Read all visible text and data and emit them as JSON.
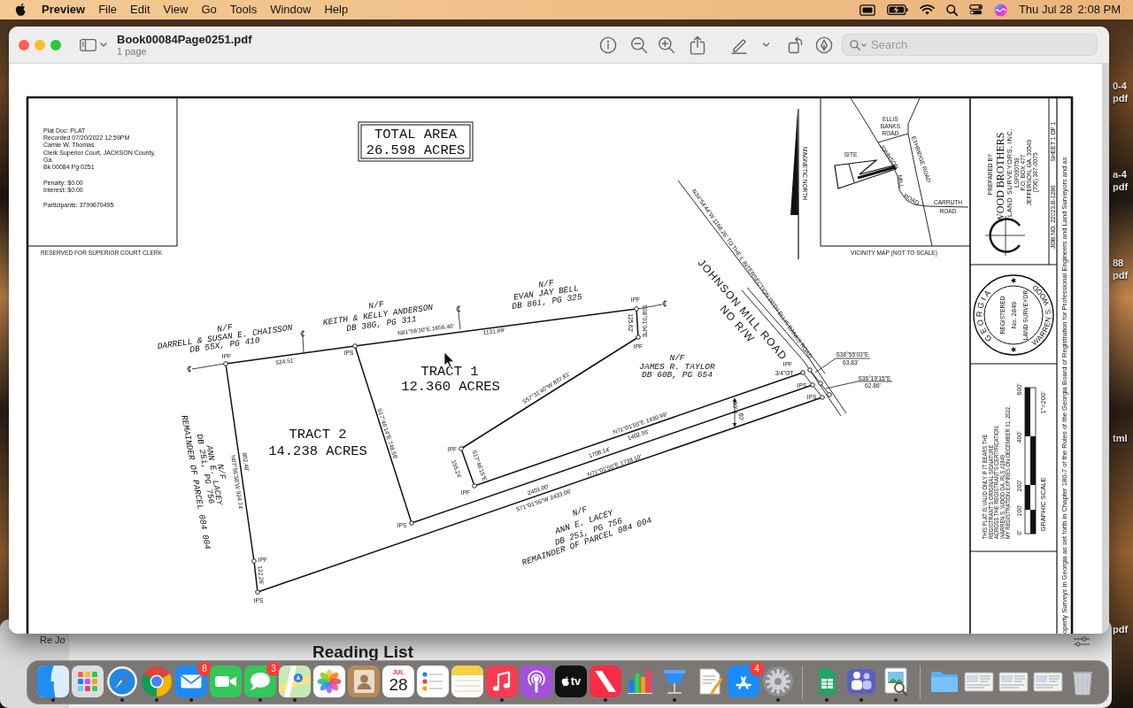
{
  "menu_bar": {
    "app": "Preview",
    "menus": [
      "File",
      "Edit",
      "View",
      "Go",
      "Tools",
      "Window",
      "Help"
    ],
    "date": "Thu Jul 28",
    "time": "2:08 PM"
  },
  "desktop_labels": [
    "0-4",
    "pdf",
    "a-4",
    "pdf",
    "88",
    "pdf",
    "tml",
    "pdf"
  ],
  "window": {
    "title": "Book00084Page0251.pdf",
    "subtitle": "1 page",
    "search_placeholder": "Search"
  },
  "plat": {
    "clerk_stamp": [
      "Plat Doc: PLAT",
      "Recorded 07/20/2022 12:59PM",
      "Camie W. Thomas",
      "Clerk Superior Court, JACKSON County,",
      "Ga.",
      "Bk 00084 Pg 0251",
      "Penalty: $0.00",
      "Interest: $0.00",
      "Participants: 3799670495"
    ],
    "clerk_caption": "RESERVED FOR SUPERIOR COURT CLERK",
    "total_area": [
      "TOTAL AREA",
      "26.598 ACRES"
    ],
    "north_label": "MAGNETIC NORTH",
    "owners": [
      [
        "N/F",
        "DARRELL & SUSAN E. CHAISSON",
        "DB 55X, PG 410"
      ],
      [
        "N/F",
        "KEITH & KELLY ANDERSON",
        "DB 38G, PG 311"
      ],
      [
        "N/F",
        "EVAN JAY BELL",
        "DB 86i, PG 325"
      ],
      [
        "N/F",
        "JAMES R. TAYLOR",
        "DB 60B, PG 654"
      ],
      [
        "N/F",
        "ANN E. LACEY",
        "DB 25i, PG 756",
        "REMAINDER OF PARCEL 084 004"
      ],
      [
        "N/F",
        "ANN E. LACEY",
        "DB 25i, PG 756",
        "REMAINDER OF PARCEL 084 004"
      ]
    ],
    "tracts": [
      {
        "name": "TRACT 1",
        "area": "12.360 ACRES"
      },
      {
        "name": "TRACT 2",
        "area": "14.238 ACRES"
      }
    ],
    "line_labels": [
      "524.51'",
      "N81°56'30\"E 1656.40'",
      "1131.89'",
      "125.62'",
      "S08°01'04\"E",
      "S57°31'40\"W 837.81'",
      "S17°46'15\"E",
      "155.24'",
      "S17°46'14\"E 748.58'",
      "802.48'",
      "N07°56'38\"W 924.74'",
      "122.26'",
      "N71°01'56\"E 1430.99'",
      "1402.56'",
      "1708.14'",
      "N71°01'56\"E 1738.10'",
      "2401.00'",
      "S71°01'56\"W 2433.06'",
      "60'",
      "60'",
      "S38°55'03\"E",
      "63.83'",
      "S36°19'15\"E",
      "62.86'"
    ],
    "corner_labels": [
      "IPF",
      "IPS",
      "IPF",
      "IPF",
      "IPF",
      "IPF",
      "IPS",
      "IPF",
      "IPS",
      "IPF",
      "3/4\"OT",
      "IPS",
      "IPS"
    ],
    "road": {
      "name": "JOHNSON MILL ROAD",
      "note": "NO R/W",
      "tie_line": "N34°54'44\"W 1168.26' TO THE ℄ INTERSECTION WITH ELLIS BANKS ROAD"
    },
    "vicinity_map": {
      "labels": [
        "ELLIS",
        "BANKS",
        "ROAD",
        "SITE",
        "JOHNSON",
        "MILL",
        "ROAD",
        "ETHRIDGE ROAD",
        "CARRUTH",
        "ROAD"
      ],
      "caption": "VICINITY MAP (NOT TO SCALE)"
    },
    "title_block": {
      "prepared_by": "PREPARED BY",
      "firm": "WOOD BROTHERS",
      "firm_details": [
        "LAND SURVEYORS, INC.",
        "LSF000758",
        "P.O. BOX 477",
        "JEFFERSON, GA. 30549",
        "(706) 387-0075"
      ],
      "job_number": "JOB NO. 22023.B-1286",
      "sheet": "SHEET 1 OF 1",
      "seal": {
        "state": "GEORGIA",
        "registered": "REGISTERED",
        "number": "No. 2849",
        "profession": "LAND SURVEYOR",
        "surveyor": "WARREN S. WOOD"
      },
      "certification": [
        "THIS PLAT IS VALID ONLY IF IT BEARS THE",
        "REGISTRANT'S ORIGINAL SIGNATURE",
        "ACROSS THE REGISTRANT'S CERTIFICATION.",
        "WARREN S. WOOD GA. RLS #2849",
        "MY REGISTRATION EXPIRES ON DECEMBER 31, 2022."
      ],
      "scale_ticks": [
        "0'",
        "100'",
        "200'",
        "400'",
        "600'"
      ],
      "scale_title": "GRAPHIC SCALE",
      "scale_ratio": "1\"=200'",
      "regulation_note": "operty Surveys in Georgia as set forth in Chapter 180-7 of the Rules of the Georgia Board of Registration for Professional Engineers and Land Surveyors and as"
    }
  },
  "reading_window": {
    "sidebar_text": "Re Jo",
    "heading": "Reading List"
  },
  "dock": {
    "apps": [
      {
        "kind": "finder",
        "running": true
      },
      {
        "kind": "launchpad",
        "running": false
      },
      {
        "kind": "safari",
        "running": true
      },
      {
        "kind": "chrome",
        "running": true
      },
      {
        "kind": "mail",
        "running": true,
        "badge": "8"
      },
      {
        "kind": "facetime",
        "running": false
      },
      {
        "kind": "messages",
        "running": true,
        "badge": "3"
      },
      {
        "kind": "maps",
        "running": true
      },
      {
        "kind": "photos",
        "running": false
      },
      {
        "kind": "contacts",
        "running": false
      },
      {
        "kind": "calendar",
        "running": false,
        "month": "JUL",
        "day": "28"
      },
      {
        "kind": "reminders",
        "running": false
      },
      {
        "kind": "notes",
        "running": false
      },
      {
        "kind": "music",
        "running": true
      },
      {
        "kind": "podcasts",
        "running": false
      },
      {
        "kind": "tv",
        "running": false,
        "label": "tv"
      },
      {
        "kind": "news",
        "running": true
      },
      {
        "kind": "chart",
        "running": false
      },
      {
        "kind": "keynote",
        "running": true
      },
      {
        "kind": "document",
        "running": false
      },
      {
        "kind": "store",
        "running": false,
        "badge": "4"
      },
      {
        "kind": "settings",
        "running": true
      }
    ],
    "extras": [
      {
        "kind": "sheet",
        "running": true
      },
      {
        "kind": "teams",
        "running": true
      },
      {
        "kind": "preview",
        "running": true
      }
    ],
    "stacks": [
      {
        "kind": "folder"
      },
      {
        "kind": "screenshot"
      },
      {
        "kind": "screenshot"
      },
      {
        "kind": "screenshot"
      },
      {
        "kind": "trash"
      }
    ]
  }
}
